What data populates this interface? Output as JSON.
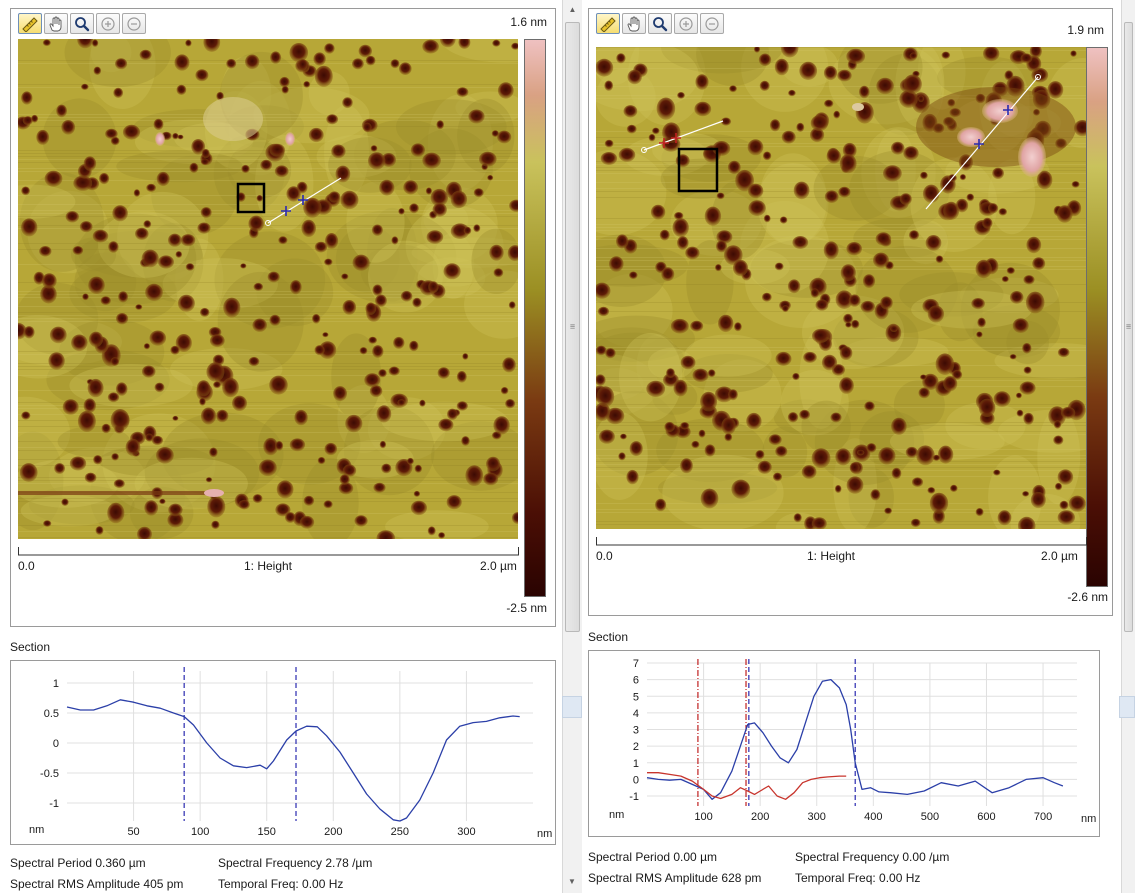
{
  "toolbar": {
    "buttons": [
      {
        "name": "ruler-tool-button",
        "icon": "ruler-icon",
        "active": true
      },
      {
        "name": "pan-tool-button",
        "icon": "hand-icon",
        "active": false
      },
      {
        "name": "zoom-tool-button",
        "icon": "magnifier-icon",
        "active": false
      },
      {
        "name": "zoom-in-button",
        "icon": "zoom-in-icon",
        "active": false
      },
      {
        "name": "zoom-out-button",
        "icon": "zoom-out-icon",
        "active": false
      }
    ]
  },
  "colors": {
    "profile_blue": "#2b3fa8",
    "profile_red": "#c8352d",
    "cursor_blue": "#2a2ab0",
    "cursor_red": "#c02020",
    "grid": "#e0e0e0"
  },
  "panels": [
    {
      "id": "left",
      "image": {
        "scale_max": "1.6 nm",
        "scale_min": "-2.5 nm",
        "x_start": "0.0",
        "x_end": "2.0 µm",
        "channel_label": "1: Height"
      },
      "section": {
        "label": "Section",
        "y_unit": "nm",
        "x_unit": "nm",
        "stats": {
          "spectral_period": "Spectral Period 0.360 µm",
          "spectral_frequency": "Spectral Frequency 2.78 /µm",
          "rms_amplitude": "Spectral RMS Amplitude 405 pm",
          "temporal_freq": "Temporal Freq: 0.00 Hz"
        }
      },
      "chart_data": {
        "type": "line",
        "xlabel": "nm",
        "ylabel": "nm",
        "xlim": [
          0,
          350
        ],
        "ylim": [
          -1.3,
          1.2
        ],
        "x_ticks": [
          50,
          100,
          150,
          200,
          250,
          300
        ],
        "y_ticks": [
          1,
          0.5,
          0,
          -0.5,
          -1
        ],
        "series": [
          {
            "color": "#2b3fa8",
            "x": [
              0,
              10,
              20,
              30,
              40,
              50,
              60,
              70,
              80,
              88,
              95,
              105,
              115,
              125,
              135,
              145,
              150,
              155,
              165,
              172,
              180,
              188,
              195,
              205,
              215,
              225,
              235,
              245,
              250,
              255,
              265,
              275,
              285,
              295,
              305,
              315,
              325,
              335,
              340
            ],
            "y": [
              0.6,
              0.55,
              0.55,
              0.62,
              0.72,
              0.68,
              0.62,
              0.58,
              0.5,
              0.44,
              0.3,
              0.0,
              -0.25,
              -0.38,
              -0.41,
              -0.37,
              -0.43,
              -0.3,
              0.05,
              0.2,
              0.28,
              0.27,
              0.12,
              -0.15,
              -0.5,
              -0.85,
              -1.1,
              -1.28,
              -1.3,
              -1.25,
              -0.95,
              -0.5,
              0.05,
              0.28,
              0.34,
              0.36,
              0.42,
              0.45,
              0.44
            ]
          }
        ],
        "cursors": [
          {
            "x": 88,
            "color": "#2a2ab0"
          },
          {
            "x": 172,
            "color": "#2a2ab0"
          }
        ]
      }
    },
    {
      "id": "right",
      "image": {
        "scale_max": "1.9 nm",
        "scale_min": "-2.6 nm",
        "x_start": "0.0",
        "x_end": "2.0 µm",
        "channel_label": "1: Height"
      },
      "section": {
        "label": "Section",
        "y_unit": "nm",
        "x_unit": "nm",
        "stats": {
          "spectral_period": "Spectral Period 0.00 µm",
          "spectral_frequency": "Spectral Frequency 0.00 /µm",
          "rms_amplitude": "Spectral RMS Amplitude 628 pm",
          "temporal_freq": "Temporal Freq: 0.00 Hz"
        }
      },
      "chart_data": {
        "type": "line",
        "xlabel": "nm",
        "ylabel": "nm",
        "xlim": [
          0,
          760
        ],
        "ylim": [
          -1.6,
          7
        ],
        "x_ticks": [
          100,
          200,
          300,
          400,
          500,
          600,
          700
        ],
        "y_ticks": [
          7,
          6,
          5,
          4,
          3,
          2,
          1,
          0,
          -1
        ],
        "series": [
          {
            "color": "#2b3fa8",
            "x": [
              0,
              20,
              40,
              60,
              80,
              100,
              115,
              130,
              150,
              165,
              178,
              190,
              205,
              220,
              235,
              250,
              265,
              280,
              295,
              310,
              325,
              340,
              352,
              360,
              368,
              380,
              395,
              410,
              430,
              460,
              490,
              520,
              550,
              580,
              610,
              640,
              670,
              700,
              720,
              735
            ],
            "y": [
              0.1,
              0.0,
              -0.05,
              0.0,
              -0.3,
              -0.6,
              -1.2,
              -0.8,
              0.5,
              2.0,
              3.3,
              3.4,
              2.8,
              2.0,
              1.3,
              1.0,
              1.8,
              3.4,
              5.0,
              5.9,
              6.0,
              5.5,
              4.5,
              3.0,
              1.0,
              -0.6,
              -0.5,
              -0.75,
              -0.8,
              -0.9,
              -0.7,
              -0.2,
              -0.4,
              -0.1,
              -0.8,
              -0.5,
              0.0,
              0.1,
              -0.2,
              -0.4
            ]
          },
          {
            "color": "#c8352d",
            "x": [
              0,
              20,
              40,
              60,
              80,
              100,
              115,
              130,
              150,
              165,
              178,
              190,
              200,
              215,
              230,
              245,
              260,
              275,
              290,
              305,
              320,
              340,
              352
            ],
            "y": [
              0.4,
              0.4,
              0.3,
              0.2,
              -0.1,
              -0.6,
              -1.0,
              -1.15,
              -0.9,
              -0.5,
              -0.7,
              -0.9,
              -0.7,
              -0.4,
              -1.0,
              -1.2,
              -0.8,
              -0.2,
              0.0,
              0.1,
              0.15,
              0.2,
              0.2
            ]
          }
        ],
        "cursors": [
          {
            "x": 90,
            "color": "#c02020"
          },
          {
            "x": 175,
            "color": "#c02020"
          },
          {
            "x": 180,
            "color": "#2a2ab0"
          },
          {
            "x": 368,
            "color": "#2a2ab0"
          }
        ]
      }
    }
  ]
}
